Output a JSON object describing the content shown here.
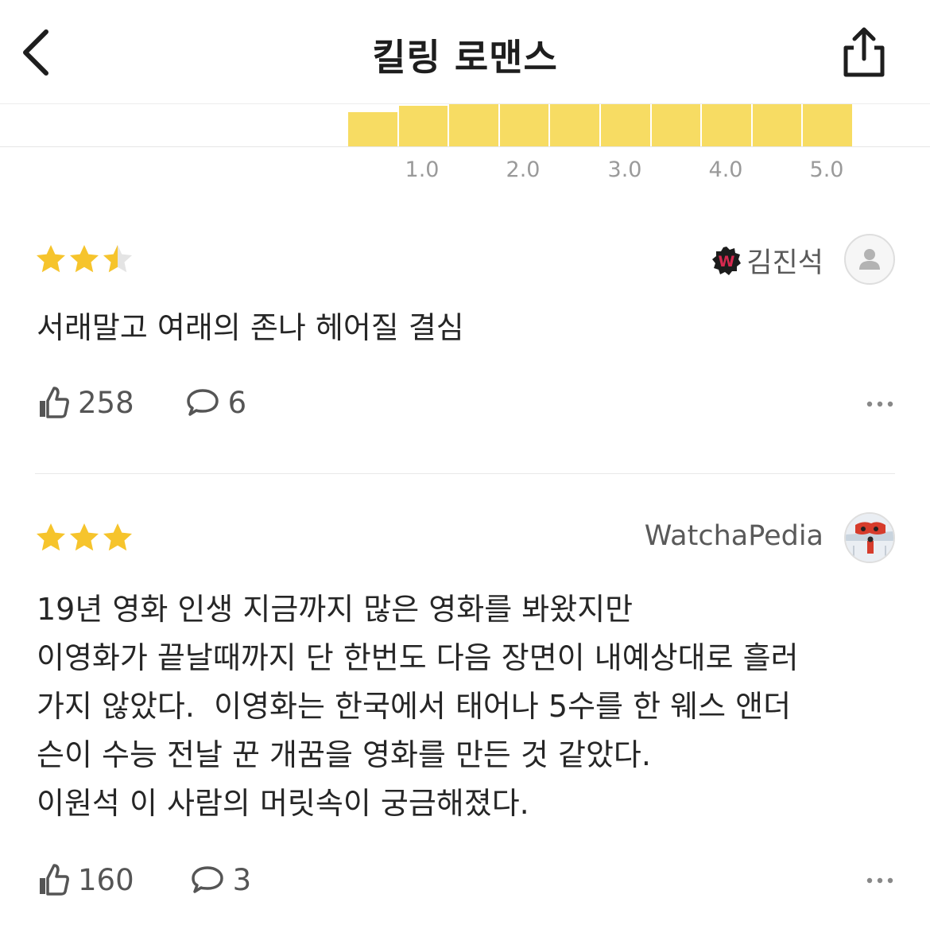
{
  "header": {
    "title": "킬링 로맨스"
  },
  "rating_distribution": {
    "ticks": [
      "1.0",
      "2.0",
      "3.0",
      "4.0",
      "5.0"
    ],
    "bar_levels": [
      0.81,
      0.96,
      1.0,
      1.0,
      1.0,
      1.0,
      1.0,
      1.0,
      1.0,
      1.0
    ],
    "bar_color": "#f7dc63"
  },
  "reviews": [
    {
      "rating": 2.5,
      "user": "김진석",
      "badge": "W",
      "text": "서래말고 여래의 존나 헤어질 결심",
      "likes": "258",
      "comments": "6"
    },
    {
      "rating": 3,
      "user": "WatchaPedia",
      "text": "19년 영화 인생 지금까지 많은 영화를 봐왔지만\n이영화가 끝날때까지 단 한번도 다음 장면이 내예상대로 흘러\n가지 않았다.  이영화는 한국에서 태어나 5수를 한 웨스 앤더\n슨이 수능 전날 꾼 개꿈을 영화를 만든 것 같았다.\n이원석 이 사람의 머릿속이 궁금해졌다.",
      "likes": "160",
      "comments": "3"
    }
  ],
  "colors": {
    "star": "#f6c42c",
    "star_empty": "#e4e4e4",
    "badge": "#d6294f"
  }
}
